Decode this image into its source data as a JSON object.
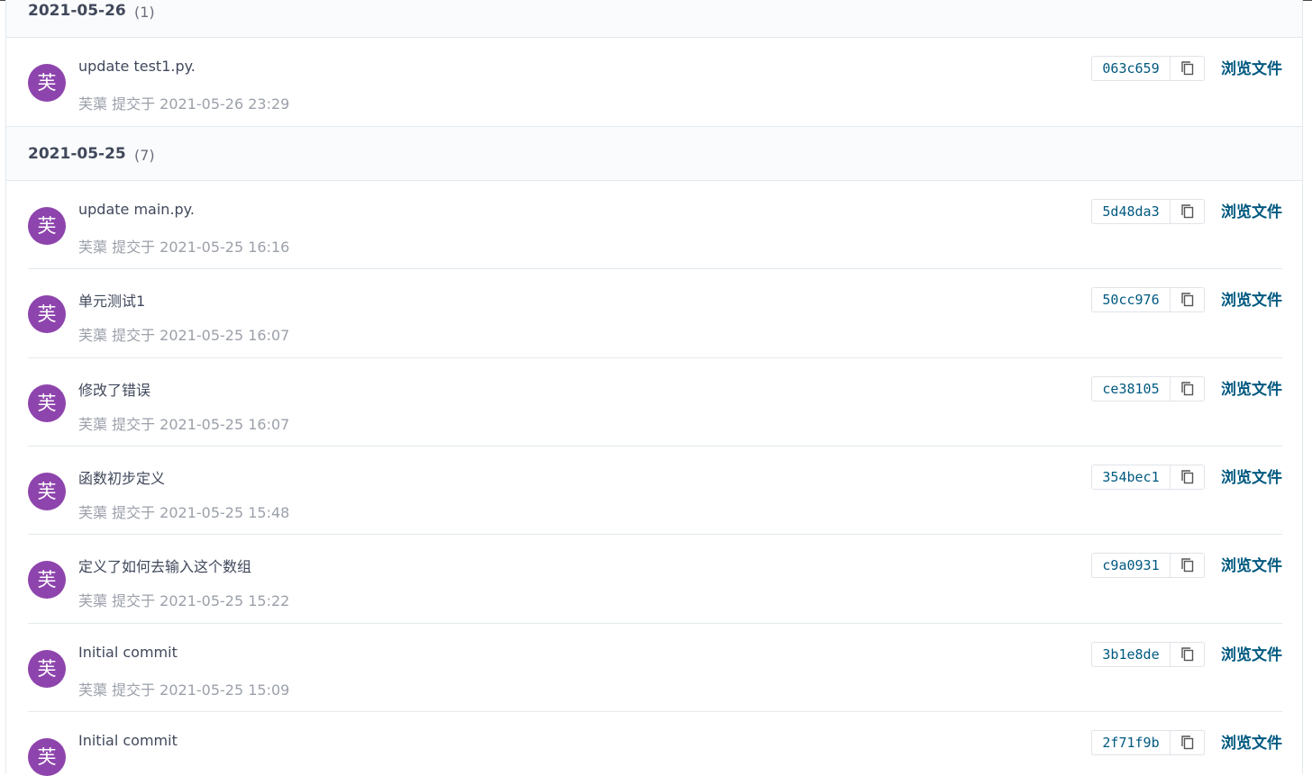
{
  "groups": [
    {
      "date": "2021-05-26",
      "count": "(1)",
      "commits": [
        {
          "title": "update test1.py.",
          "avatar": "芙",
          "meta": "芙蕖 提交于 2021-05-26 23:29",
          "sha": "063c659",
          "browse": "浏览文件"
        }
      ]
    },
    {
      "date": "2021-05-25",
      "count": "(7)",
      "commits": [
        {
          "title": "update main.py.",
          "avatar": "芙",
          "meta": "芙蕖 提交于 2021-05-25 16:16",
          "sha": "5d48da3",
          "browse": "浏览文件"
        },
        {
          "title": "单元测试1",
          "avatar": "芙",
          "meta": "芙蕖 提交于 2021-05-25 16:07",
          "sha": "50cc976",
          "browse": "浏览文件"
        },
        {
          "title": "修改了错误",
          "avatar": "芙",
          "meta": "芙蕖 提交于 2021-05-25 16:07",
          "sha": "ce38105",
          "browse": "浏览文件"
        },
        {
          "title": "函数初步定义",
          "avatar": "芙",
          "meta": "芙蕖 提交于 2021-05-25 15:48",
          "sha": "354bec1",
          "browse": "浏览文件"
        },
        {
          "title": "定义了如何去输入这个数组",
          "avatar": "芙",
          "meta": "芙蕖 提交于 2021-05-25 15:22",
          "sha": "c9a0931",
          "browse": "浏览文件"
        },
        {
          "title": "Initial commit",
          "avatar": "芙",
          "meta": "芙蕖 提交于 2021-05-25 15:09",
          "sha": "3b1e8de",
          "browse": "浏览文件"
        },
        {
          "title": "Initial commit",
          "avatar": "芙",
          "meta": "",
          "sha": "2f71f9b",
          "browse": "浏览文件"
        }
      ]
    }
  ],
  "colors": {
    "accent": "#005980",
    "avatar_bg": "#8e44ad",
    "meta_text": "#9ba0aa",
    "header_bg": "#fafbfc"
  },
  "icons": {
    "copy": "copy-icon"
  }
}
